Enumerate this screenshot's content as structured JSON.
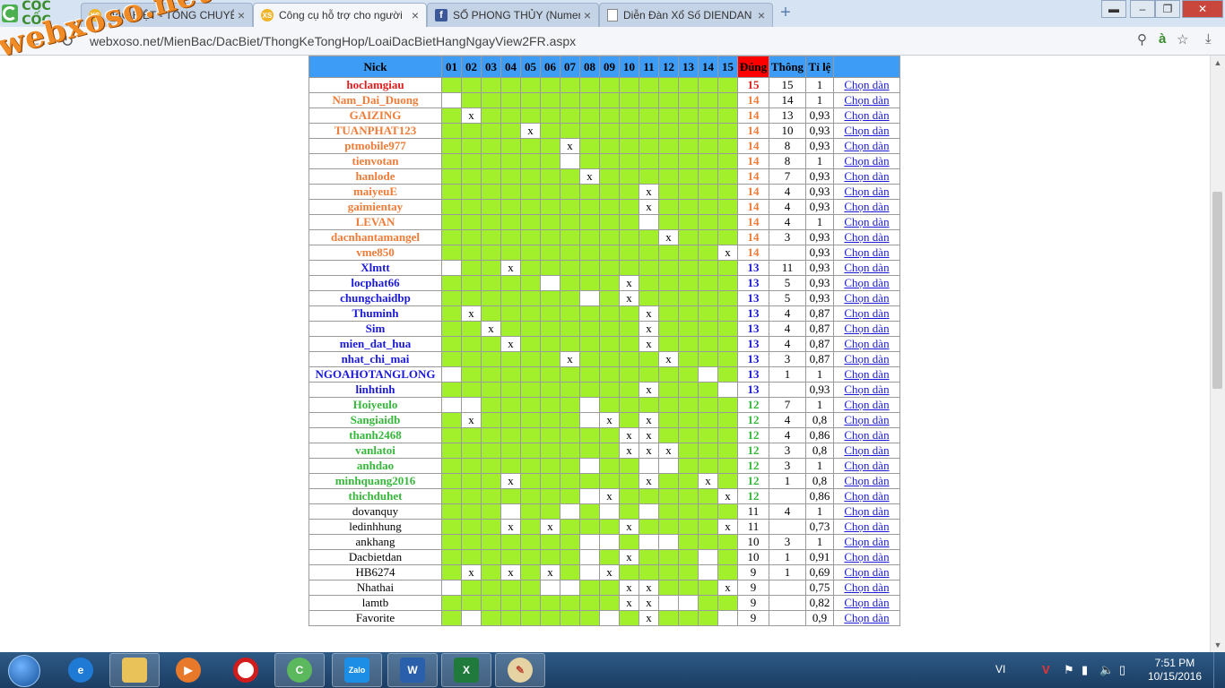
{
  "browser": {
    "brand": "CỐC CỐC",
    "tabs": [
      {
        "title": "ĐẶC BIỆT - TỔNG CHUYÊN",
        "icon": "xs",
        "active": false
      },
      {
        "title": "Công cụ hỗ trợ cho người",
        "icon": "xs",
        "active": true
      },
      {
        "title": "SỐ PHONG THỦY (Numero",
        "icon": "fb",
        "active": false
      },
      {
        "title": "Diễn Đàn Xổ Số DIENDAN",
        "icon": "doc",
        "active": false
      }
    ],
    "url": "webxoso.net/MienBac/DacBiet/ThongKeTongHop/LoaiDacBietHangNgayView2FR.aspx",
    "coccoc_a": "à"
  },
  "watermark": "webxoso.net",
  "table": {
    "headers": {
      "nick": "Nick",
      "days": [
        "01",
        "02",
        "03",
        "04",
        "05",
        "06",
        "07",
        "08",
        "09",
        "10",
        "11",
        "12",
        "13",
        "14",
        "15"
      ],
      "dung": "Đúng",
      "thong": "Thông",
      "tile": "Tỉ lệ",
      "action": ""
    },
    "rows": [
      {
        "nick": "hoclamgiau",
        "color": "red",
        "cells": "ggggggggggggggg",
        "dung": "15",
        "thong": "15",
        "tile": "1",
        "link": "Chọn dàn"
      },
      {
        "nick": "Nam_Dai_Duong",
        "color": "orange",
        "cells": "wgggggggggggggg",
        "dung": "14",
        "thong": "14",
        "tile": "1",
        "link": "Chọn dàn"
      },
      {
        "nick": "GAIZING",
        "color": "orange",
        "cells": "gxggggggggggggg",
        "dung": "14",
        "thong": "13",
        "tile": "0,93",
        "link": "Chọn dàn"
      },
      {
        "nick": "TUANPHAT123",
        "color": "orange",
        "cells": "ggggxgggggggggg",
        "dung": "14",
        "thong": "10",
        "tile": "0,93",
        "link": "Chọn dàn"
      },
      {
        "nick": "ptmobile977",
        "color": "orange",
        "cells": "ggggggxgggggggg",
        "dung": "14",
        "thong": "8",
        "tile": "0,93",
        "link": "Chọn dàn"
      },
      {
        "nick": "tienvotan",
        "color": "orange",
        "cells": "ggggggwgggggggg",
        "dung": "14",
        "thong": "8",
        "tile": "1",
        "link": "Chọn dàn"
      },
      {
        "nick": "hanlode",
        "color": "orange",
        "cells": "gggggggxggggggg",
        "dung": "14",
        "thong": "7",
        "tile": "0,93",
        "link": "Chọn dàn"
      },
      {
        "nick": "maiyeuE",
        "color": "orange",
        "cells": "ggggggggggxgggg",
        "dung": "14",
        "thong": "4",
        "tile": "0,93",
        "link": "Chọn dàn"
      },
      {
        "nick": "gaimientay",
        "color": "orange",
        "cells": "ggggggggggxgggg",
        "dung": "14",
        "thong": "4",
        "tile": "0,93",
        "link": "Chọn dàn"
      },
      {
        "nick": "LEVAN",
        "color": "orange",
        "cells": "ggggggggggwgggg",
        "dung": "14",
        "thong": "4",
        "tile": "1",
        "link": "Chọn dàn"
      },
      {
        "nick": "dacnhantamangel",
        "color": "orange",
        "cells": "gggggggggggxggg",
        "dung": "14",
        "thong": "3",
        "tile": "0,93",
        "link": "Chọn dàn"
      },
      {
        "nick": "vme850",
        "color": "orange",
        "cells": "ggggggggggggggx",
        "dung": "14",
        "thong": "",
        "tile": "0,93",
        "link": "Chọn dàn"
      },
      {
        "nick": "Xlmtt",
        "color": "blue",
        "cells": "wggxggggggggggg",
        "dung": "13",
        "thong": "11",
        "tile": "0,93",
        "link": "Chọn dàn"
      },
      {
        "nick": "locphat66",
        "color": "blue",
        "cells": "gggggwgggxggggg",
        "dung": "13",
        "thong": "5",
        "tile": "0,93",
        "link": "Chọn dàn"
      },
      {
        "nick": "chungchaidbp",
        "color": "blue",
        "cells": "gggggggwgxggggg",
        "dung": "13",
        "thong": "5",
        "tile": "0,93",
        "link": "Chọn dàn"
      },
      {
        "nick": "Thuminh",
        "color": "blue",
        "cells": "gxggggggggxgggg",
        "dung": "13",
        "thong": "4",
        "tile": "0,87",
        "link": "Chọn dàn"
      },
      {
        "nick": "Sim",
        "color": "blue",
        "cells": "ggxgggggggxgggg",
        "dung": "13",
        "thong": "4",
        "tile": "0,87",
        "link": "Chọn dàn"
      },
      {
        "nick": "mien_dat_hua",
        "color": "blue",
        "cells": "gggxggggggxgggg",
        "dung": "13",
        "thong": "4",
        "tile": "0,87",
        "link": "Chọn dàn"
      },
      {
        "nick": "nhat_chi_mai",
        "color": "blue",
        "cells": "ggggggxggggxggg",
        "dung": "13",
        "thong": "3",
        "tile": "0,87",
        "link": "Chọn dàn"
      },
      {
        "nick": "NGOAHOTANGLONG",
        "color": "blue",
        "cells": "wggggggggggggwg",
        "dung": "13",
        "thong": "1",
        "tile": "1",
        "link": "Chọn dàn"
      },
      {
        "nick": "linhtinh",
        "color": "blue",
        "cells": "ggggggggggxgggw",
        "dung": "13",
        "thong": "",
        "tile": "0,93",
        "link": "Chọn dàn"
      },
      {
        "nick": "Hoiyeulo",
        "color": "green",
        "cells": "wwgggggwggggggg",
        "dung": "12",
        "thong": "7",
        "tile": "1",
        "link": "Chọn dàn"
      },
      {
        "nick": "Sangiaidb",
        "color": "green",
        "cells": "gxgggggwxgxgggg",
        "dung": "12",
        "thong": "4",
        "tile": "0,8",
        "link": "Chọn dàn"
      },
      {
        "nick": "thanh2468",
        "color": "green",
        "cells": "gggggggggxxgggg",
        "dung": "12",
        "thong": "4",
        "tile": "0,86",
        "link": "Chọn dàn"
      },
      {
        "nick": "vanlatoi",
        "color": "green",
        "cells": "gggggggggxxxggg",
        "dung": "12",
        "thong": "3",
        "tile": "0,8",
        "link": "Chọn dàn"
      },
      {
        "nick": "anhdao",
        "color": "green",
        "cells": "gggggggwggwwggg",
        "dung": "12",
        "thong": "3",
        "tile": "1",
        "link": "Chọn dàn"
      },
      {
        "nick": "minhquang2016",
        "color": "green",
        "cells": "gggxggggggxggxg",
        "dung": "12",
        "thong": "1",
        "tile": "0,8",
        "link": "Chọn dàn"
      },
      {
        "nick": "thichduhet",
        "color": "green",
        "cells": "gggggggwxgggggx",
        "dung": "12",
        "thong": "",
        "tile": "0,86",
        "link": "Chọn dàn"
      },
      {
        "nick": "dovanquy",
        "color": "black",
        "cells": "gggwggwgwgwgggg",
        "dung": "11",
        "thong": "4",
        "tile": "1",
        "link": "Chọn dàn"
      },
      {
        "nick": "ledinhhung",
        "color": "black",
        "cells": "gggxgxgggxggggx",
        "dung": "11",
        "thong": "",
        "tile": "0,73",
        "link": "Chọn dàn"
      },
      {
        "nick": "ankhang",
        "color": "black",
        "cells": "gggggggwwgwwggg",
        "dung": "10",
        "thong": "3",
        "tile": "1",
        "link": "Chọn dàn"
      },
      {
        "nick": "Dacbietdan",
        "color": "black",
        "cells": "gggggggwgxgggwg",
        "dung": "10",
        "thong": "1",
        "tile": "0,91",
        "link": "Chọn dàn"
      },
      {
        "nick": "HB6274",
        "color": "black",
        "cells": "gxgxgxgwxggggwg",
        "dung": "9",
        "thong": "1",
        "tile": "0,69",
        "link": "Chọn dàn"
      },
      {
        "nick": "Nhathai",
        "color": "black",
        "cells": "wggggwwggxxgggx",
        "dung": "9",
        "thong": "",
        "tile": "0,75",
        "link": "Chọn dàn"
      },
      {
        "nick": "lamtb",
        "color": "black",
        "cells": "gggggggggxxwwgg",
        "dung": "9",
        "thong": "",
        "tile": "0,82",
        "link": "Chọn dàn"
      },
      {
        "nick": "Favorite",
        "color": "black",
        "cells": "gwggggggwgxgggw",
        "dung": "9",
        "thong": "",
        "tile": "0,9",
        "link": "Chọn dàn"
      }
    ]
  },
  "taskbar": {
    "lang": "VI",
    "time": "7:51 PM",
    "date": "10/15/2016",
    "apps": [
      "ie-icon",
      "explorer-icon",
      "media-player-icon",
      "opera-icon",
      "coccoc-icon",
      "zalo-icon",
      "word-icon",
      "excel-icon",
      "paint-icon"
    ],
    "zalo_label": "Zalo"
  }
}
